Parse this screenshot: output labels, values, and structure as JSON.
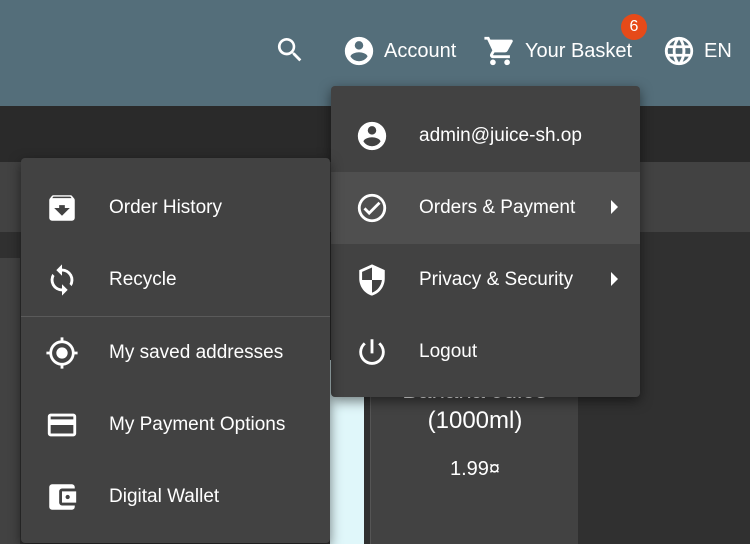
{
  "toolbar": {
    "account_label": "Account",
    "basket_label": "Your Basket",
    "basket_count": "6",
    "language_label": "EN"
  },
  "product": {
    "name": "Banana Juice (1000ml)",
    "price": "1.99¤"
  },
  "account_menu": {
    "items": [
      {
        "label": "admin@juice-sh.op",
        "icon": "account-circle-icon"
      },
      {
        "label": "Orders & Payment",
        "icon": "check-circle-icon"
      },
      {
        "label": "Privacy & Security",
        "icon": "shield-icon"
      },
      {
        "label": "Logout",
        "icon": "power-icon"
      }
    ]
  },
  "orders_menu": {
    "items": [
      {
        "label": "Order History",
        "icon": "archive-icon"
      },
      {
        "label": "Recycle",
        "icon": "recycle-icon"
      },
      {
        "label": "My saved addresses",
        "icon": "location-icon"
      },
      {
        "label": "My Payment Options",
        "icon": "credit-card-icon"
      },
      {
        "label": "Digital Wallet",
        "icon": "wallet-icon"
      }
    ]
  },
  "colors": {
    "toolbar": "#546e7a",
    "badge": "#e64a19",
    "menu": "#424242",
    "background": "#303030"
  }
}
